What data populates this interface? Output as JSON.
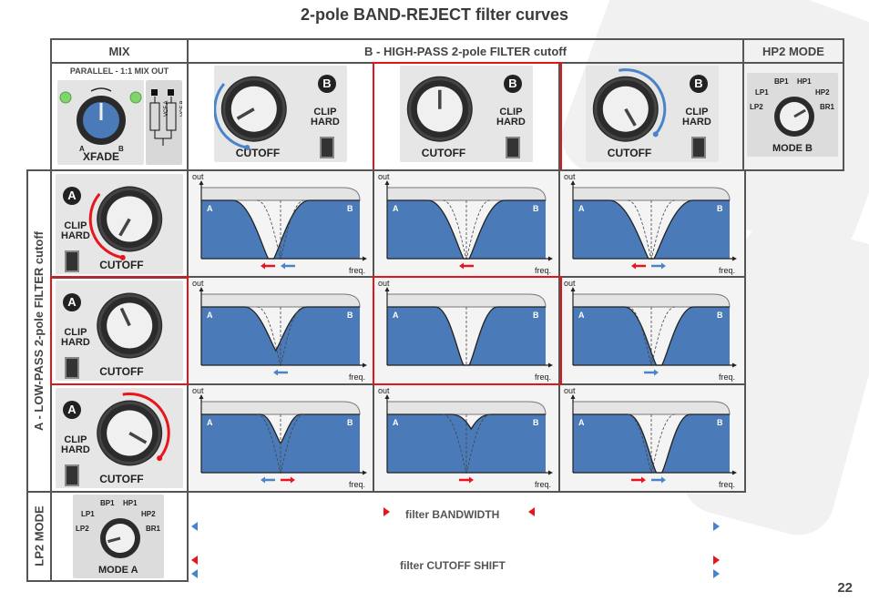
{
  "title": "2-pole BAND-REJECT filter curves",
  "page_number": "22",
  "headers": {
    "mix": "MIX",
    "b_filter": "B - HIGH-PASS 2-pole FILTER cutoff",
    "hp2_mode": "HP2 MODE",
    "a_filter": "A - LOW-PASS 2-pole FILTER cutoff",
    "lp2_mode": "LP2 MODE"
  },
  "mix_panel": {
    "caption": "PARALLEL - 1:1 MIX OUT",
    "knob_label": "XFADE",
    "left": "A",
    "right": "B",
    "jack_a": "VCF A",
    "jack_b": "VCF B"
  },
  "b_knobs": [
    {
      "badge": "B",
      "clip": "CLIP",
      "hard": "HARD",
      "label": "CUTOFF",
      "position": "low",
      "arrow": "counter-clockwise",
      "highlighted": false
    },
    {
      "badge": "B",
      "clip": "CLIP",
      "hard": "HARD",
      "label": "CUTOFF",
      "position": "center",
      "arrow": "none",
      "highlighted": true
    },
    {
      "badge": "B",
      "clip": "CLIP",
      "hard": "HARD",
      "label": "CUTOFF",
      "position": "high",
      "arrow": "clockwise",
      "highlighted": false
    }
  ],
  "a_knobs": [
    {
      "badge": "A",
      "clip": "CLIP",
      "hard": "HARD",
      "label": "CUTOFF",
      "position": "low",
      "arrow": "counter-clockwise",
      "highlighted": false
    },
    {
      "badge": "A",
      "clip": "CLIP",
      "hard": "HARD",
      "label": "CUTOFF",
      "position": "center",
      "arrow": "none",
      "highlighted": true
    },
    {
      "badge": "A",
      "clip": "CLIP",
      "hard": "HARD",
      "label": "CUTOFF",
      "position": "high",
      "arrow": "clockwise",
      "highlighted": false
    }
  ],
  "mode_b": {
    "label": "MODE B",
    "options": [
      "LP2",
      "LP1",
      "BP1",
      "HP1",
      "HP2",
      "BR1"
    ],
    "selected": "HP2"
  },
  "mode_a": {
    "label": "MODE A",
    "options": [
      "LP2",
      "LP1",
      "BP1",
      "HP1",
      "HP2",
      "BR1"
    ],
    "selected": "LP2"
  },
  "legend": {
    "bandwidth": "filter BANDWIDTH",
    "cutoff_shift": "filter CUTOFF SHIFT"
  },
  "colors": {
    "fill_blue": "#4a7ab8",
    "arrow_red": "#e8161c",
    "arrow_blue": "#4a84c8",
    "highlight_red": "#e0161b"
  },
  "chart_data": {
    "type": "area",
    "xlabel": "freq.",
    "ylabel": "out",
    "left_label": "A",
    "right_label": "B",
    "grid": [
      [
        {
          "notch_center": 0.44,
          "notch_depth": 1.0,
          "notch_width": "wide",
          "arrows": [
            "red-left",
            "blue-left"
          ]
        },
        {
          "notch_center": 0.5,
          "notch_depth": 1.0,
          "notch_width": "wide",
          "arrows": [
            "red-left"
          ]
        },
        {
          "notch_center": 0.5,
          "notch_depth": 1.0,
          "notch_width": "widest",
          "arrows": [
            "red-left",
            "blue-right"
          ]
        }
      ],
      [
        {
          "notch_center": 0.47,
          "notch_depth": 0.75,
          "notch_width": "medium",
          "arrows": [
            "blue-left"
          ]
        },
        {
          "notch_center": 0.5,
          "notch_depth": 1.0,
          "notch_width": "medium",
          "arrows": []
        },
        {
          "notch_center": 0.55,
          "notch_depth": 1.0,
          "notch_width": "medium-wide",
          "arrows": [
            "blue-right"
          ]
        }
      ],
      [
        {
          "notch_center": 0.5,
          "notch_depth": 0.5,
          "notch_width": "narrow",
          "arrows": [
            "blue-left",
            "red-right"
          ]
        },
        {
          "notch_center": 0.53,
          "notch_depth": 0.25,
          "notch_width": "narrow",
          "arrows": [
            "red-right"
          ]
        },
        {
          "notch_center": 0.55,
          "notch_depth": 1.0,
          "notch_width": "medium",
          "arrows": [
            "red-right",
            "blue-right"
          ]
        }
      ]
    ]
  }
}
